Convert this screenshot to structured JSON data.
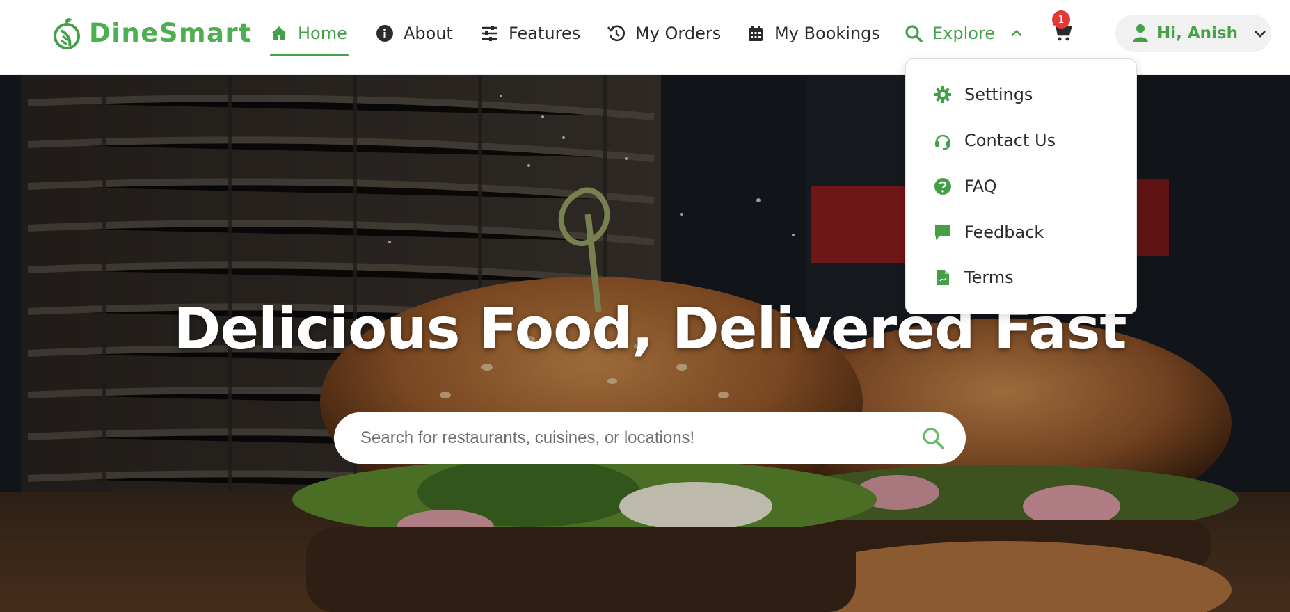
{
  "brand": {
    "name": "DineSmart"
  },
  "nav": {
    "items": [
      {
        "label": "Home",
        "icon": "home-icon",
        "active": true
      },
      {
        "label": "About",
        "icon": "info-icon"
      },
      {
        "label": "Features",
        "icon": "sliders-icon"
      },
      {
        "label": "My Orders",
        "icon": "history-icon"
      },
      {
        "label": "My Bookings",
        "icon": "calendar-icon"
      },
      {
        "label": "Explore",
        "icon": "search-icon",
        "expanded": true
      }
    ]
  },
  "cart": {
    "count": "1",
    "icon": "cart-icon"
  },
  "user": {
    "greeting": "Hi, Anish",
    "icon": "user-icon"
  },
  "explore_menu": {
    "items": [
      {
        "label": "Settings",
        "icon": "gear-icon"
      },
      {
        "label": "Contact Us",
        "icon": "headset-icon"
      },
      {
        "label": "FAQ",
        "icon": "question-icon"
      },
      {
        "label": "Feedback",
        "icon": "comment-icon"
      },
      {
        "label": "Terms",
        "icon": "document-icon"
      }
    ]
  },
  "hero": {
    "title": "Delicious Food, Delivered Fast",
    "search_placeholder": "Search for restaurants, cuisines, or locations!"
  },
  "colors": {
    "accent": "#43a047",
    "badge": "#e53935",
    "text": "#2b2b2b"
  }
}
